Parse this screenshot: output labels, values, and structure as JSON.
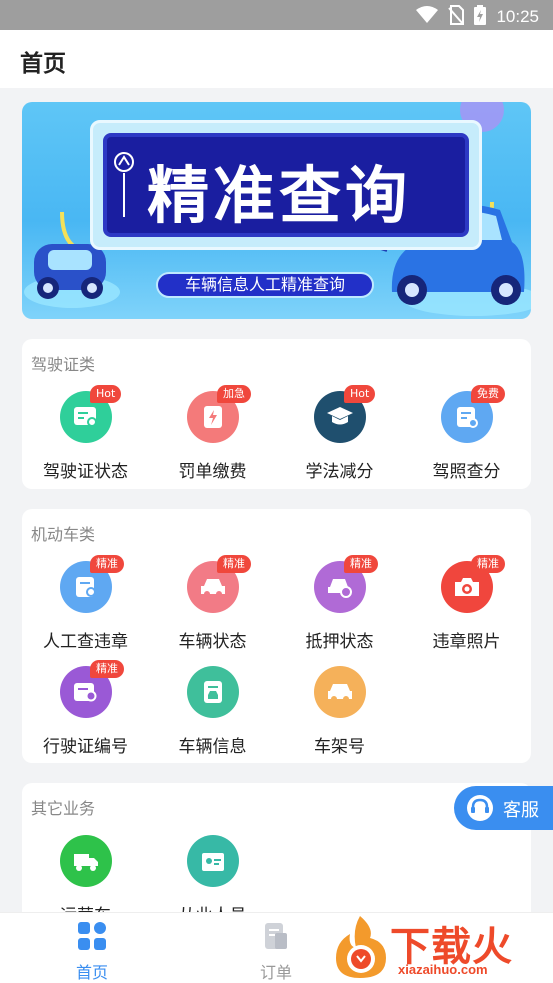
{
  "status_bar": {
    "time": "10:25"
  },
  "app_bar": {
    "title": "首页"
  },
  "banner": {
    "headline": "精准查询",
    "subtitle": "车辆信息人工精准查询"
  },
  "sections": [
    {
      "title": "驾驶证类",
      "items": [
        {
          "label": "驾驶证状态",
          "badge": "Hot",
          "icon": "license-card-icon",
          "color": "#2fcf9a"
        },
        {
          "label": "罚单缴费",
          "badge": "加急",
          "icon": "ticket-payment-icon",
          "color": "#f47a7a"
        },
        {
          "label": "学法减分",
          "badge": "Hot",
          "icon": "graduation-cap-icon",
          "color": "#1f4f6e"
        },
        {
          "label": "驾照查分",
          "badge": "免费",
          "icon": "license-score-icon",
          "color": "#5fa8f2"
        }
      ]
    },
    {
      "title": "机动车类",
      "items": [
        {
          "label": "人工查违章",
          "badge": "精准",
          "icon": "violation-search-icon",
          "color": "#5fa8f2"
        },
        {
          "label": "车辆状态",
          "badge": "精准",
          "icon": "car-status-icon",
          "color": "#f27b86"
        },
        {
          "label": "抵押状态",
          "badge": "精准",
          "icon": "car-mortgage-icon",
          "color": "#b06ad6"
        },
        {
          "label": "违章照片",
          "badge": "精准",
          "icon": "camera-icon",
          "color": "#f0463d"
        },
        {
          "label": "行驶证编号",
          "badge": "精准",
          "icon": "vehicle-license-icon",
          "color": "#9a59d6"
        },
        {
          "label": "车辆信息",
          "badge": "",
          "icon": "vehicle-info-icon",
          "color": "#3fbf9b"
        },
        {
          "label": "车架号",
          "badge": "",
          "icon": "vin-icon",
          "color": "#f5b15a"
        }
      ]
    },
    {
      "title": "其它业务",
      "items": [
        {
          "label": "运营车",
          "badge": "",
          "icon": "truck-icon",
          "color": "#2ec24a"
        },
        {
          "label": "从业人员",
          "badge": "",
          "icon": "practitioner-icon",
          "color": "#37b9a6"
        }
      ]
    }
  ],
  "customer_service": {
    "label": "客服"
  },
  "tabs": [
    {
      "label": "首页",
      "icon": "home-grid-icon",
      "active": true
    },
    {
      "label": "订单",
      "icon": "order-icon",
      "active": false
    }
  ],
  "watermark": {
    "brand": "下载火",
    "url": "xiazaihuo.com"
  },
  "colors": {
    "accent": "#3a8ef0",
    "badge": "#f0473c",
    "inactive_tab": "#999999"
  }
}
